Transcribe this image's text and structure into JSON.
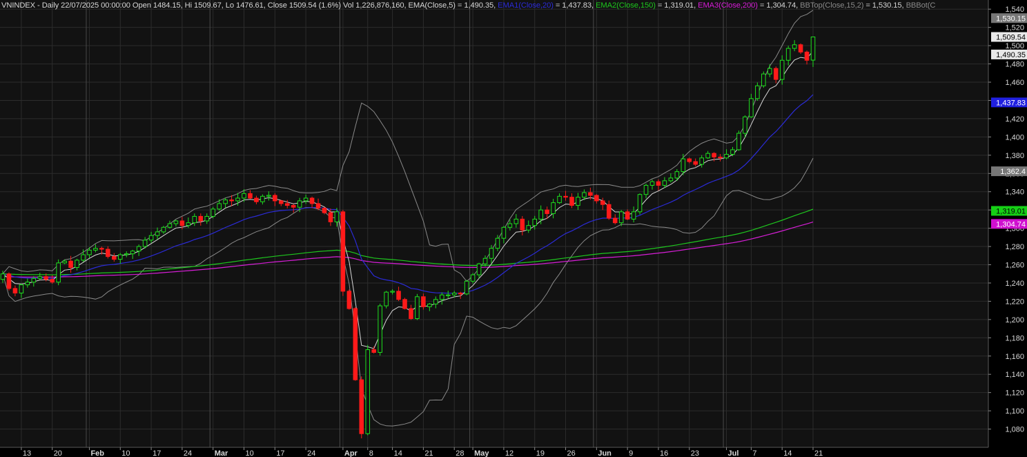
{
  "header": {
    "symbol": "VNINDEX",
    "interval": "Daily",
    "datetime": "22/07/2025 00:00:00",
    "ohlc_text": "Open 1484.15, Hi 1509.67, Lo 1476.61, Close 1509.54 (1.6%) Vol 1,226,876,160",
    "indicators": [
      {
        "label": "EMA(Close,5)",
        "value": "1,490.35",
        "color": "#d8d8d8"
      },
      {
        "label": "EMA1(Close,20)",
        "value": "1,437.83",
        "color": "#2b2bd8"
      },
      {
        "label": "EMA2(Close,150)",
        "value": "1,319.01",
        "color": "#1ec81e"
      },
      {
        "label": "EMA3(Close,200)",
        "value": "1,304.74",
        "color": "#d81ed8"
      },
      {
        "label": "BBTop(Close,15,2)",
        "value": "1,530.15",
        "color": "#8a8a8a"
      },
      {
        "label": "BBBot(C",
        "value": "",
        "color": "#8a8a8a"
      }
    ]
  },
  "colors": {
    "background": "#121212",
    "grid": "#2c2c2c",
    "up_candle": "#1ee01e",
    "down_candle": "#ff1a1a",
    "ema5": "#d8d8d8",
    "ema20": "#2b2bd8",
    "ema150": "#1ec81e",
    "ema200": "#d81ed8",
    "bollinger": "#8a8a8a",
    "axis_text": "#d8d8d8"
  },
  "chart_data": {
    "type": "candlestick",
    "title": "VNINDEX - Daily",
    "xlabel": "",
    "ylabel": "",
    "ylim": [
      1060,
      1550
    ],
    "grid": true,
    "y_ticks": [
      1080,
      1100,
      1120,
      1140,
      1160,
      1180,
      1200,
      1220,
      1240,
      1260,
      1280,
      1300,
      1320,
      1340,
      1360,
      1380,
      1400,
      1420,
      1440,
      1460,
      1480,
      1500,
      1520,
      1540
    ],
    "y_tick_labels": [
      "1,080",
      "1,100",
      "1,120",
      "1,140",
      "1,160",
      "1,180",
      "1,200",
      "1,220",
      "1,240",
      "1,260",
      "1,280",
      "1,300",
      "1,320",
      "1,340",
      "1,360",
      "1,380",
      "1,400",
      "1,420",
      "1,440",
      "1,460",
      "1,480",
      "1,500",
      "1,520",
      "1,540"
    ],
    "x_tick_labels": [
      {
        "label": "13",
        "index": 3,
        "bold": false
      },
      {
        "label": "20",
        "index": 8,
        "bold": false
      },
      {
        "label": "Feb",
        "index": 14,
        "bold": true
      },
      {
        "label": "10",
        "index": 19,
        "bold": false
      },
      {
        "label": "17",
        "index": 24,
        "bold": false
      },
      {
        "label": "24",
        "index": 29,
        "bold": false
      },
      {
        "label": "Mar",
        "index": 34,
        "bold": true
      },
      {
        "label": "10",
        "index": 39,
        "bold": false
      },
      {
        "label": "17",
        "index": 44,
        "bold": false
      },
      {
        "label": "24",
        "index": 49,
        "bold": false
      },
      {
        "label": "Apr",
        "index": 55,
        "bold": true
      },
      {
        "label": "8",
        "index": 59,
        "bold": false
      },
      {
        "label": "14",
        "index": 63,
        "bold": false
      },
      {
        "label": "21",
        "index": 68,
        "bold": false
      },
      {
        "label": "28",
        "index": 73,
        "bold": false
      },
      {
        "label": "May",
        "index": 76,
        "bold": true
      },
      {
        "label": "12",
        "index": 81,
        "bold": false
      },
      {
        "label": "19",
        "index": 86,
        "bold": false
      },
      {
        "label": "26",
        "index": 91,
        "bold": false
      },
      {
        "label": "Jun",
        "index": 96,
        "bold": true
      },
      {
        "label": "9",
        "index": 101,
        "bold": false
      },
      {
        "label": "16",
        "index": 106,
        "bold": false
      },
      {
        "label": "23",
        "index": 111,
        "bold": false
      },
      {
        "label": "Jul",
        "index": 117,
        "bold": true
      },
      {
        "label": "7",
        "index": 121,
        "bold": false
      },
      {
        "label": "14",
        "index": 126,
        "bold": false
      },
      {
        "label": "21",
        "index": 131,
        "bold": false
      }
    ],
    "month_separators": [
      14,
      34,
      55,
      76,
      96,
      117
    ],
    "close": [
      1250,
      1234,
      1229,
      1238,
      1241,
      1245,
      1247,
      1244,
      1241,
      1262,
      1264,
      1257,
      1265,
      1271,
      1276,
      1278,
      1277,
      1269,
      1266,
      1271,
      1272,
      1275,
      1280,
      1287,
      1292,
      1296,
      1301,
      1305,
      1308,
      1303,
      1306,
      1313,
      1308,
      1313,
      1321,
      1327,
      1331,
      1330,
      1333,
      1338,
      1333,
      1329,
      1335,
      1336,
      1330,
      1327,
      1325,
      1323,
      1330,
      1333,
      1327,
      1322,
      1317,
      1307,
      1318,
      1231,
      1212,
      1134,
      1075,
      1167,
      1164,
      1215,
      1230,
      1231,
      1222,
      1212,
      1201,
      1225,
      1214,
      1217,
      1222,
      1227,
      1227,
      1229,
      1228,
      1242,
      1249,
      1261,
      1267,
      1278,
      1289,
      1301,
      1305,
      1310,
      1298,
      1303,
      1310,
      1320,
      1316,
      1328,
      1335,
      1334,
      1325,
      1334,
      1339,
      1336,
      1330,
      1326,
      1311,
      1306,
      1318,
      1310,
      1318,
      1337,
      1347,
      1351,
      1347,
      1352,
      1355,
      1362,
      1376,
      1373,
      1370,
      1377,
      1382,
      1378,
      1377,
      1381,
      1386,
      1404,
      1422,
      1442,
      1456,
      1469,
      1475,
      1463,
      1484,
      1497,
      1501,
      1493,
      1484,
      1509.54
    ],
    "ohlc": {
      "last_bar": {
        "open": 1484.15,
        "high": 1509.67,
        "low": 1476.61,
        "close": 1509.54,
        "change_pct": 1.6,
        "volume": 1226876160
      }
    },
    "series": [
      {
        "name": "EMA(Close,5)",
        "last_value": 1490.35
      },
      {
        "name": "EMA1(Close,20)",
        "last_value": 1437.83
      },
      {
        "name": "EMA2(Close,150)",
        "last_value": 1319.01
      },
      {
        "name": "EMA3(Close,200)",
        "last_value": 1304.74
      },
      {
        "name": "BBTop(Close,15,2)",
        "last_value": 1530.15
      },
      {
        "name": "BBBot(Close,15,2)",
        "last_value": 1362.4
      }
    ],
    "price_tags": [
      {
        "label": "1,530.15",
        "value": 1530.15,
        "bg": "#777777",
        "fg": "#ffffff"
      },
      {
        "label": "1,509.54",
        "value": 1509.54,
        "bg": "#e8e8e8",
        "fg": "#000000"
      },
      {
        "label": "1,490.35",
        "value": 1490.35,
        "bg": "#e8e8e8",
        "fg": "#000000"
      },
      {
        "label": "1,437.83",
        "value": 1437.83,
        "bg": "#2020e0",
        "fg": "#ffffff"
      },
      {
        "label": "1,362.4",
        "value": 1362.4,
        "bg": "#777777",
        "fg": "#ffffff"
      },
      {
        "label": "1,319.01",
        "value": 1319.01,
        "bg": "#16d016",
        "fg": "#000000"
      },
      {
        "label": "1,304.74",
        "value": 1304.74,
        "bg": "#d010d0",
        "fg": "#ffffff"
      }
    ]
  }
}
